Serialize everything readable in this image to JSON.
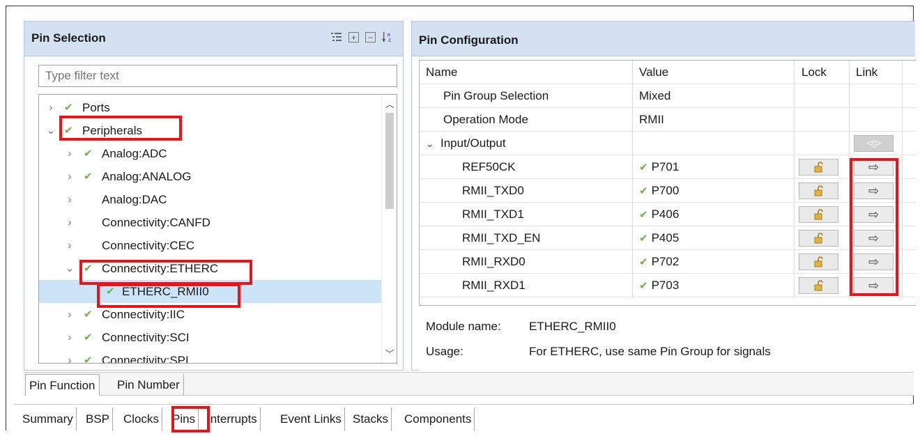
{
  "pin_selection": {
    "title": "Pin Selection",
    "filter_placeholder": "Type filter text",
    "tree": [
      {
        "label": "Ports",
        "check": true,
        "expanded": false
      },
      {
        "label": "Peripherals",
        "check": true,
        "expanded": true
      },
      {
        "label": "Analog:ADC",
        "check": true,
        "expanded": false
      },
      {
        "label": "Analog:ANALOG",
        "check": true,
        "expanded": false
      },
      {
        "label": "Analog:DAC",
        "check": false,
        "expanded": false
      },
      {
        "label": "Connectivity:CANFD",
        "check": false,
        "expanded": false
      },
      {
        "label": "Connectivity:CEC",
        "check": false,
        "expanded": false
      },
      {
        "label": "Connectivity:ETHERC",
        "check": true,
        "expanded": true
      },
      {
        "label": "ETHERC_RMII0",
        "check": true,
        "selected": true
      },
      {
        "label": "Connectivity:IIC",
        "check": true,
        "expanded": false
      },
      {
        "label": "Connectivity:SCI",
        "check": true,
        "expanded": false
      },
      {
        "label": "Connectivity:SPI",
        "check": true,
        "expanded": false
      }
    ]
  },
  "pin_configuration": {
    "title": "Pin Configuration",
    "columns": {
      "name": "Name",
      "value": "Value",
      "lock": "Lock",
      "link": "Link"
    },
    "rows": [
      {
        "name": "Pin Group Selection",
        "value": "Mixed"
      },
      {
        "name": "Operation Mode",
        "value": "RMII"
      },
      {
        "name": "Input/Output",
        "value": ""
      },
      {
        "name": "REF50CK",
        "value": "P701"
      },
      {
        "name": "RMII_TXD0",
        "value": "P700"
      },
      {
        "name": "RMII_TXD1",
        "value": "P406"
      },
      {
        "name": "RMII_TXD_EN",
        "value": "P405"
      },
      {
        "name": "RMII_RXD0",
        "value": "P702"
      },
      {
        "name": "RMII_RXD1",
        "value": "P703"
      }
    ],
    "module_label": "Module name:",
    "module_value": "ETHERC_RMII0",
    "usage_label": "Usage:",
    "usage_value": "For ETHERC, use same Pin Group for signals"
  },
  "pin_tabs": [
    "Pin Function",
    "Pin Number"
  ],
  "editor_tabs": [
    "Summary",
    "BSP",
    "Clocks",
    "Pins",
    "Interrupts",
    "Event Links",
    "Stacks",
    "Components"
  ],
  "colors": {
    "highlight": "#e8141c",
    "check": "#6cb24a",
    "header": "#d3e1f1",
    "selected": "#cce4f7"
  }
}
